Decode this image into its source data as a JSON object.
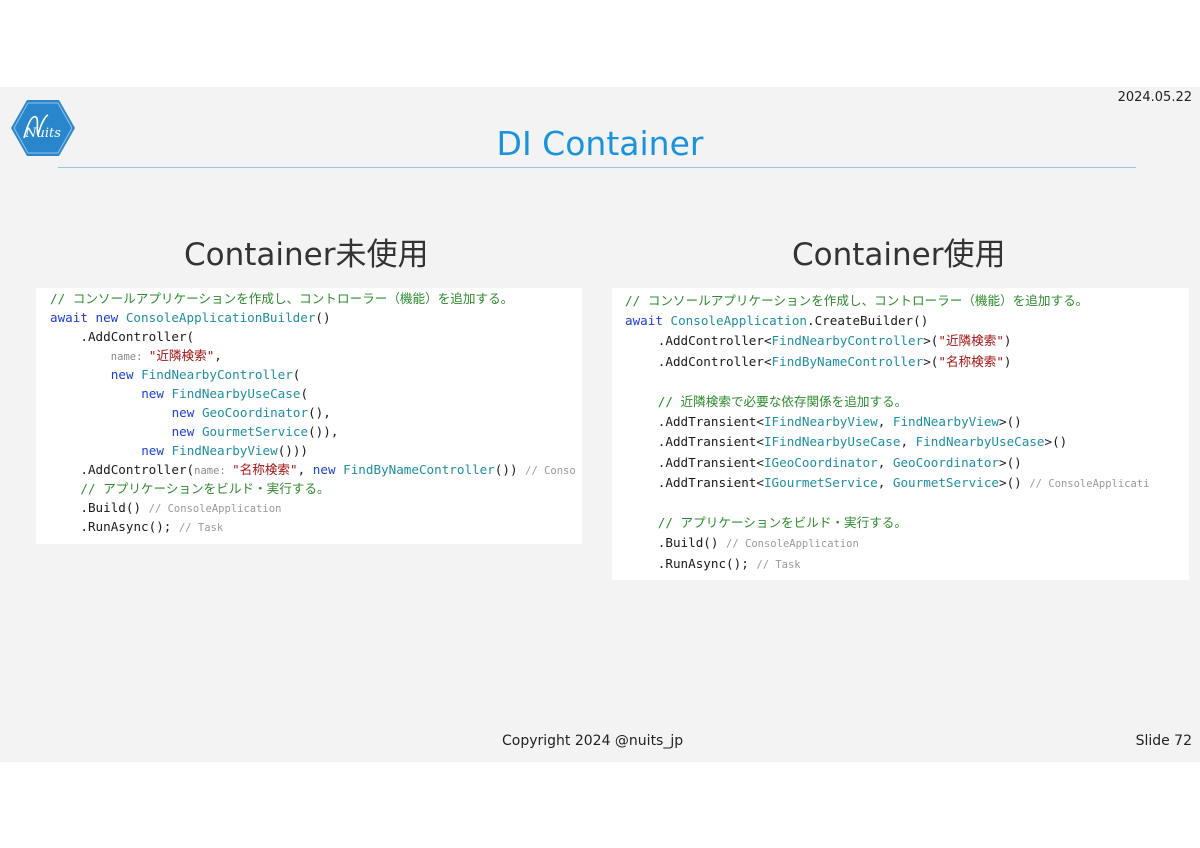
{
  "date": "2024.05.22",
  "logo_text": "Nuits",
  "title": "DI Container",
  "left_heading": "Container未使用",
  "right_heading": "Container使用",
  "left_code": [
    {
      "indent": 0,
      "segs": [
        {
          "c": "c",
          "t": "// コンソールアプリケーションを作成し、コントローラー（機能）を追加する。"
        }
      ]
    },
    {
      "indent": 0,
      "segs": [
        {
          "c": "k",
          "t": "await "
        },
        {
          "c": "k",
          "t": "new "
        },
        {
          "c": "t",
          "t": "ConsoleApplicationBuilder"
        },
        {
          "c": "m",
          "t": "()"
        }
      ]
    },
    {
      "indent": 4,
      "segs": [
        {
          "c": "m",
          "t": ".AddController("
        }
      ]
    },
    {
      "indent": 8,
      "segs": [
        {
          "c": "hn",
          "t": "name: "
        },
        {
          "c": "s",
          "t": "\"近隣検索\""
        },
        {
          "c": "m",
          "t": ","
        }
      ]
    },
    {
      "indent": 8,
      "segs": [
        {
          "c": "k",
          "t": "new "
        },
        {
          "c": "t",
          "t": "FindNearbyController"
        },
        {
          "c": "m",
          "t": "("
        }
      ]
    },
    {
      "indent": 12,
      "segs": [
        {
          "c": "k",
          "t": "new "
        },
        {
          "c": "t",
          "t": "FindNearbyUseCase"
        },
        {
          "c": "m",
          "t": "("
        }
      ]
    },
    {
      "indent": 16,
      "segs": [
        {
          "c": "k",
          "t": "new "
        },
        {
          "c": "t",
          "t": "GeoCoordinator"
        },
        {
          "c": "m",
          "t": "(),"
        }
      ]
    },
    {
      "indent": 16,
      "segs": [
        {
          "c": "k",
          "t": "new "
        },
        {
          "c": "t",
          "t": "GourmetService"
        },
        {
          "c": "m",
          "t": "()),"
        }
      ]
    },
    {
      "indent": 12,
      "segs": [
        {
          "c": "k",
          "t": "new "
        },
        {
          "c": "t",
          "t": "FindNearbyView"
        },
        {
          "c": "m",
          "t": "()))"
        }
      ]
    },
    {
      "indent": 4,
      "segs": [
        {
          "c": "m",
          "t": ".AddController("
        },
        {
          "c": "hn",
          "t": "name: "
        },
        {
          "c": "s",
          "t": "\"名称検索\""
        },
        {
          "c": "m",
          "t": ", "
        },
        {
          "c": "k",
          "t": "new "
        },
        {
          "c": "t",
          "t": "FindByNameController"
        },
        {
          "c": "m",
          "t": "()) "
        },
        {
          "c": "g",
          "t": "// Conso"
        }
      ]
    },
    {
      "indent": 4,
      "segs": [
        {
          "c": "c",
          "t": "// アプリケーションをビルド・実行する。"
        }
      ]
    },
    {
      "indent": 4,
      "segs": [
        {
          "c": "m",
          "t": ".Build() "
        },
        {
          "c": "g",
          "t": "// ConsoleApplication"
        }
      ]
    },
    {
      "indent": 4,
      "segs": [
        {
          "c": "m",
          "t": ".RunAsync(); "
        },
        {
          "c": "g",
          "t": "// Task"
        }
      ]
    }
  ],
  "right_code": [
    {
      "indent": 0,
      "segs": [
        {
          "c": "c",
          "t": "// コンソールアプリケーションを作成し、コントローラー（機能）を追加する。"
        }
      ]
    },
    {
      "indent": 0,
      "segs": [
        {
          "c": "k",
          "t": "await "
        },
        {
          "c": "t",
          "t": "ConsoleApplication"
        },
        {
          "c": "m",
          "t": ".CreateBuilder()"
        }
      ]
    },
    {
      "indent": 4,
      "segs": [
        {
          "c": "m",
          "t": ".AddController<"
        },
        {
          "c": "t",
          "t": "FindNearbyController"
        },
        {
          "c": "m",
          "t": ">("
        },
        {
          "c": "s",
          "t": "\"近隣検索\""
        },
        {
          "c": "m",
          "t": ")"
        }
      ]
    },
    {
      "indent": 4,
      "segs": [
        {
          "c": "m",
          "t": ".AddController<"
        },
        {
          "c": "t",
          "t": "FindByNameController"
        },
        {
          "c": "m",
          "t": ">("
        },
        {
          "c": "s",
          "t": "\"名称検索\""
        },
        {
          "c": "m",
          "t": ")"
        }
      ]
    },
    {
      "indent": 0,
      "segs": []
    },
    {
      "indent": 4,
      "segs": [
        {
          "c": "c",
          "t": "// 近隣検索で必要な依存関係を追加する。"
        }
      ]
    },
    {
      "indent": 4,
      "segs": [
        {
          "c": "m",
          "t": ".AddTransient<"
        },
        {
          "c": "t",
          "t": "IFindNearbyView"
        },
        {
          "c": "m",
          "t": ", "
        },
        {
          "c": "t",
          "t": "FindNearbyView"
        },
        {
          "c": "m",
          "t": ">()"
        }
      ]
    },
    {
      "indent": 4,
      "segs": [
        {
          "c": "m",
          "t": ".AddTransient<"
        },
        {
          "c": "t",
          "t": "IFindNearbyUseCase"
        },
        {
          "c": "m",
          "t": ", "
        },
        {
          "c": "t",
          "t": "FindNearbyUseCase"
        },
        {
          "c": "m",
          "t": ">()"
        }
      ]
    },
    {
      "indent": 4,
      "segs": [
        {
          "c": "m",
          "t": ".AddTransient<"
        },
        {
          "c": "t",
          "t": "IGeoCoordinator"
        },
        {
          "c": "m",
          "t": ", "
        },
        {
          "c": "t",
          "t": "GeoCoordinator"
        },
        {
          "c": "m",
          "t": ">()"
        }
      ]
    },
    {
      "indent": 4,
      "segs": [
        {
          "c": "m",
          "t": ".AddTransient<"
        },
        {
          "c": "t",
          "t": "IGourmetService"
        },
        {
          "c": "m",
          "t": ", "
        },
        {
          "c": "t",
          "t": "GourmetService"
        },
        {
          "c": "m",
          "t": ">() "
        },
        {
          "c": "g",
          "t": "// ConsoleApplicati"
        }
      ]
    },
    {
      "indent": 0,
      "segs": []
    },
    {
      "indent": 4,
      "segs": [
        {
          "c": "c",
          "t": "// アプリケーションをビルド・実行する。"
        }
      ]
    },
    {
      "indent": 4,
      "segs": [
        {
          "c": "m",
          "t": ".Build() "
        },
        {
          "c": "g",
          "t": "// ConsoleApplication"
        }
      ]
    },
    {
      "indent": 4,
      "segs": [
        {
          "c": "m",
          "t": ".RunAsync(); "
        },
        {
          "c": "g",
          "t": "// Task"
        }
      ]
    }
  ],
  "footer": {
    "copyright": "Copyright 2024 @nuits_jp",
    "slide": "Slide 72"
  }
}
